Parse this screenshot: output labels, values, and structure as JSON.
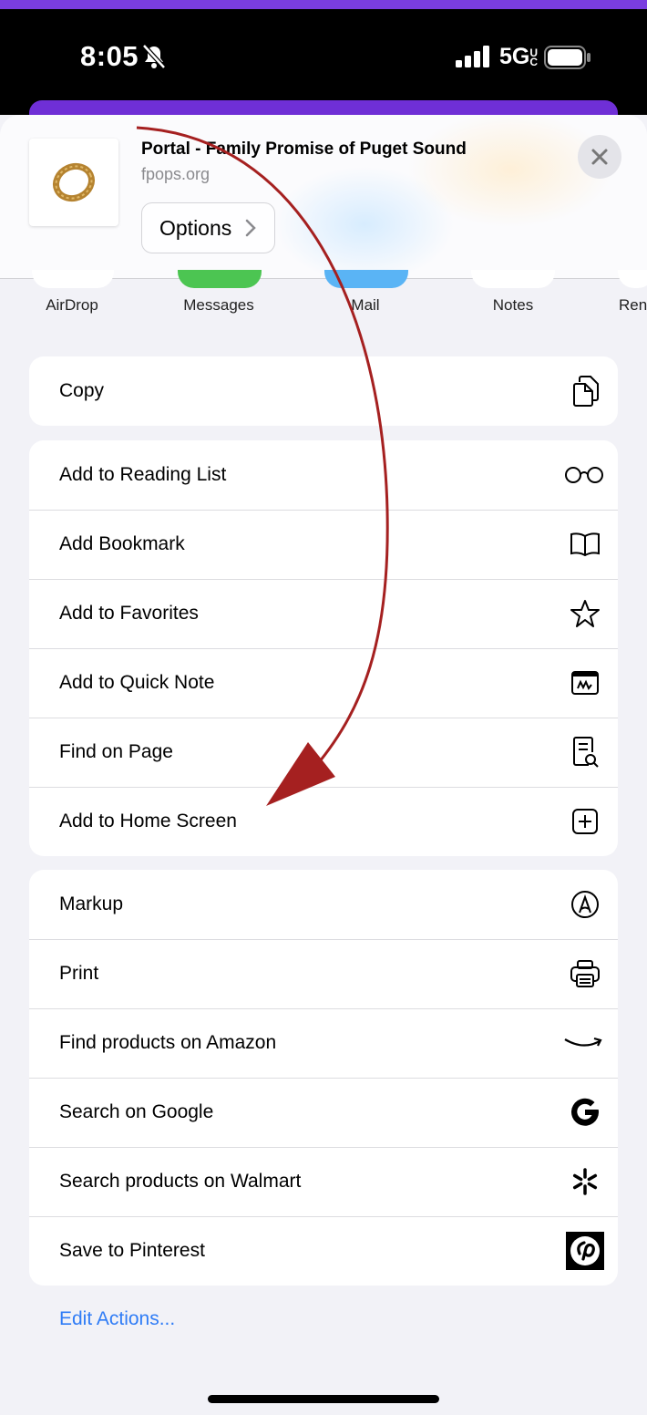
{
  "status_bar": {
    "time": "8:05",
    "network": "5G",
    "network_suffix": "UC"
  },
  "header": {
    "title": "Portal - Family Promise of Puget Sound",
    "url": "fpops.org",
    "options_label": "Options"
  },
  "apps": [
    {
      "label": "AirDrop"
    },
    {
      "label": "Messages"
    },
    {
      "label": "Mail"
    },
    {
      "label": "Notes"
    },
    {
      "label": "Ren"
    }
  ],
  "group1": [
    {
      "label": "Copy",
      "icon": "copy-icon"
    }
  ],
  "group2": [
    {
      "label": "Add to Reading List",
      "icon": "glasses-icon"
    },
    {
      "label": "Add Bookmark",
      "icon": "book-icon"
    },
    {
      "label": "Add to Favorites",
      "icon": "star-icon"
    },
    {
      "label": "Add to Quick Note",
      "icon": "quick-note-icon"
    },
    {
      "label": "Find on Page",
      "icon": "find-doc-icon"
    },
    {
      "label": "Add to Home Screen",
      "icon": "plus-square-icon"
    }
  ],
  "group3": [
    {
      "label": "Markup",
      "icon": "markup-icon"
    },
    {
      "label": "Print",
      "icon": "printer-icon"
    },
    {
      "label": "Find products on Amazon",
      "icon": "amazon-icon"
    },
    {
      "label": "Search on Google",
      "icon": "google-icon"
    },
    {
      "label": "Search products on Walmart",
      "icon": "walmart-icon"
    },
    {
      "label": "Save to Pinterest",
      "icon": "pinterest-icon"
    }
  ],
  "edit_actions_label": "Edit Actions...",
  "colors": {
    "accent": "#7a3de0",
    "link": "#2f7cf6",
    "arrow": "#a52020",
    "messages": "#4cc552",
    "mail": "#5ab4f5"
  }
}
